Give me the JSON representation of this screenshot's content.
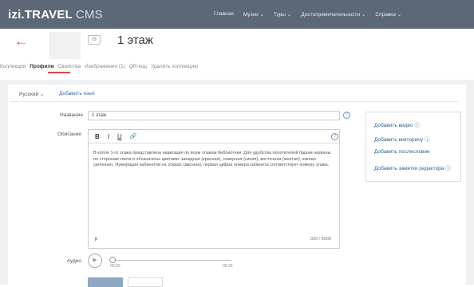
{
  "topbar": {
    "logo": "izi.TRAVEL",
    "cms": "CMS",
    "nav": [
      "Главная",
      "Музеи ⌄",
      "Туры ⌄",
      "Достопримечательности ⌄",
      "Справка ⌄"
    ]
  },
  "header": {
    "title": "1 этаж",
    "tabs": [
      "Коллекция",
      "Профили",
      "Свойства",
      "Изображения (1)",
      "QR-код",
      "Удалить коллекцию"
    ]
  },
  "language": {
    "current": "Русский ⌄",
    "add": "Добавить язык"
  },
  "form": {
    "name_label": "Название",
    "name_value": "1 этаж",
    "desc_label": "Описание",
    "desc_text": "В копле 1-го этажа представлена навигация по всем этажам библиотеки. Для удобства посетителей башни названы по сторонам света и обозначены цветами: западная (красная), северная (синяя), восточная (желтая), южная (зеленая). Нумерация кабинетов на этажах сквозная, первая цифра номера кабинета соответствует номеру этажа.",
    "p_tag": "p",
    "counter": "326 / 5000",
    "audio_label": "Аудио",
    "audio_start": "00:00",
    "audio_end": "00:25"
  },
  "toolbar": {
    "bold": "B",
    "italic": "I",
    "underline": "U",
    "link": "🔗"
  },
  "sidebar": {
    "items": [
      "Добавить видео",
      "Добавить викторину",
      "Добавить послесловие",
      "Добавить заметки редактора"
    ]
  }
}
